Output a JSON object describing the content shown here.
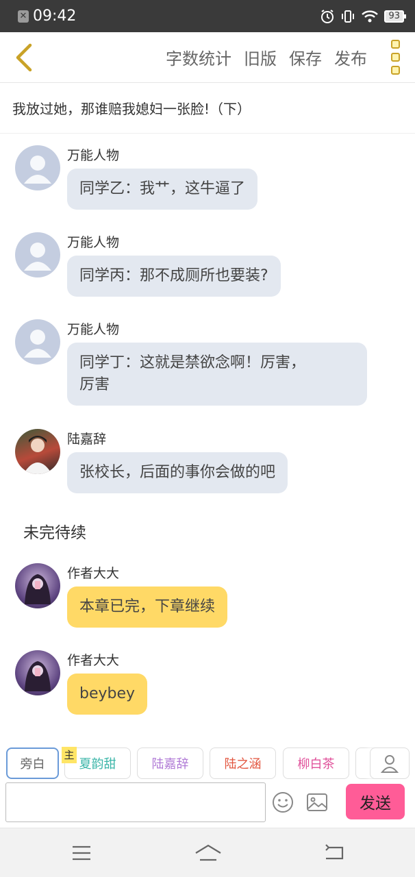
{
  "statusbar": {
    "time": "09:42",
    "battery": "93",
    "notification_glyph": "✕"
  },
  "toolbar": {
    "word_count": "字数统计",
    "old_version": "旧版",
    "save": "保存",
    "publish": "发布"
  },
  "chapter": {
    "title": "我放过她，那谁赔我媳妇一张脸!（下）"
  },
  "messages": [
    {
      "name": "万能人物",
      "text": "同学乙：我艹，这牛逼了",
      "avatar": "default-avatar"
    },
    {
      "name": "万能人物",
      "text": "同学丙：那不成厕所也要装?",
      "avatar": "default-avatar"
    },
    {
      "name": "万能人物",
      "text_line1": "同学丁：这就是禁欲念啊！厉害，",
      "text_line2": "厉害",
      "avatar": "default-avatar"
    },
    {
      "name": "陆嘉辞",
      "text": "张校长，后面的事你会做的吧",
      "avatar": "character-avatar"
    }
  ],
  "narration": "未完待续",
  "author_messages": [
    {
      "name": "作者大大",
      "text": "本章已完，下章继续"
    },
    {
      "name": "作者大大",
      "text": "beybey"
    }
  ],
  "characters": [
    {
      "label": "旁白",
      "color": "#666666"
    },
    {
      "label": "夏韵甜",
      "color": "#3ab5a8"
    },
    {
      "label": "陆嘉辞",
      "color": "#b07ad6"
    },
    {
      "label": "陆之涵",
      "color": "#e2553f"
    },
    {
      "label": "柳白茶",
      "color": "#e0509a"
    }
  ],
  "main_tag": "主",
  "input": {
    "value": "",
    "send_label": "发送"
  },
  "colors": {
    "accent_yellow": "#ffd966",
    "send_pink": "#ff5c97",
    "bubble_gray": "#e3e8f0"
  }
}
